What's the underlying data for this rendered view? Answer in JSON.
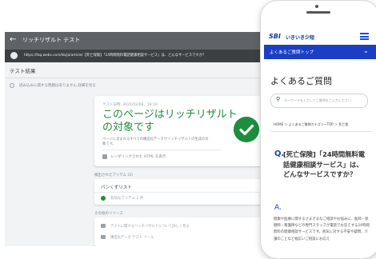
{
  "desktop": {
    "header": {
      "title": "リッチリザルト テスト"
    },
    "url_bar": {
      "url": "https://faq.webs.com/kb/ja/article/【死亡保険】「24時間無料電話健康相談サービス」は、どんなサービスですか？"
    },
    "results_label": "テスト結果",
    "note": "読み込みに関する問題はありません  詳細を見る",
    "result_card": {
      "meta": "テスト日時: 2021/02/08、19:18",
      "headline_line1": "このページはリッチリザルト",
      "headline_line2": "の対象です",
      "description": "ページに含まれるすべての構造化データがリッチリザルトの生成の対象です。",
      "screenshot_label": "レンダリングされた HTML を表示"
    },
    "detected_items_label": "検出されたアイテム (2)",
    "breadcrumb_row": {
      "label": "パンくずリスト",
      "item": "有効なアイテム 1 件"
    },
    "other_resources_label": "その他のリソース",
    "resource_rows": [
      "テストに関するリッチリザルトについて詳しく見る",
      "構造化データ テスト ツール"
    ]
  },
  "phone": {
    "logo_sbi": "SBI",
    "logo_name": "いきいき少短",
    "nav_label": "よくあるご質問トップ",
    "page_title": "よくあるご質問",
    "search_placeholder": "キーワードを入力してご質問をご入力ください",
    "breadcrumbs": "HOME  ＞ よくあるご質問カテゴリーTOP  ＞ 死亡保",
    "question_mark": "Q.",
    "question_text": "[死亡保険]「24時間無料電話健康相談サービス」は、どんなサービスですか？",
    "answer_mark": "A.",
    "answer_text": "健康や医療に関するさまざまなご相談やお悩みに、医師・保健師・看護師などの専門スタッフが電話でお答えする24時間無料の健康相談サービスです。病気に対する不安や疑問、介護のことなど幅広いご相談にお応え"
  },
  "colors": {
    "google_green": "#1e8e3e",
    "sbi_blue": "#1a3fc4",
    "header_gray": "#5f6368"
  },
  "icons": [
    "back-arrow-icon",
    "google-logo-icon",
    "check-circle-icon",
    "menu-icon",
    "search-icon",
    "chevron-down-icon"
  ]
}
